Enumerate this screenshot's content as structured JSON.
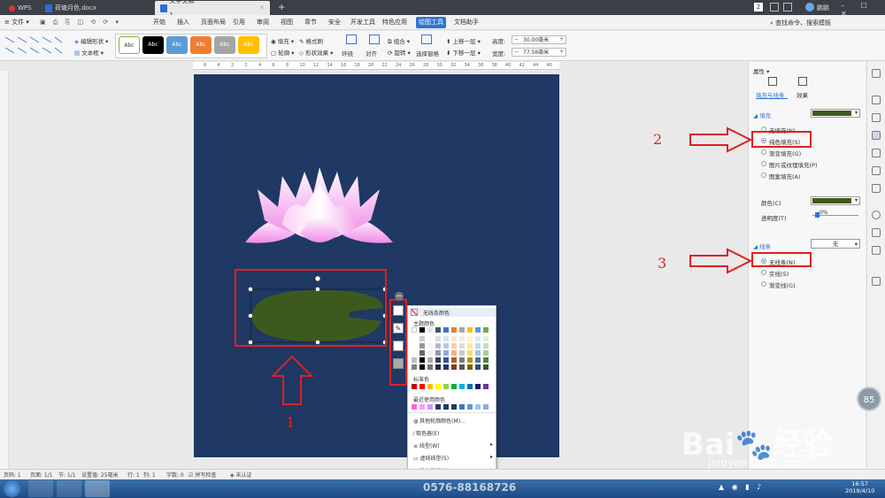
{
  "titlebar": {
    "tabs": [
      {
        "label": "WPS"
      },
      {
        "label": "荷塘月色.docx"
      },
      {
        "label": "文字文稿1"
      }
    ],
    "page_count": "2",
    "user": "鹏鹏"
  },
  "menubar": {
    "file": "文件",
    "items": [
      "开始",
      "插入",
      "页面布局",
      "引用",
      "审阅",
      "视图",
      "章节",
      "安全",
      "开发工具",
      "特色应用",
      "绘图工具",
      "文档助手"
    ],
    "active": "绘图工具",
    "search": "查找命令、搜索模板"
  },
  "ribbon": {
    "edit_shape": "编辑形状",
    "textbox": "文本框",
    "style_label": "Abc",
    "fill": "填充",
    "format_painter": "格式刷",
    "outline": "轮廓",
    "shape_effect": "形状效果",
    "wrap": "环绕",
    "align": "对齐",
    "group": "组合",
    "rotate": "旋转",
    "selection_pane": "选择窗格",
    "bring_forward": "上移一层",
    "send_backward": "下移一层",
    "height_label": "高度:",
    "height_value": "30.00毫米",
    "width_label": "宽度:",
    "width_value": "77.56毫米"
  },
  "ruler": [
    "6",
    "4",
    "2",
    "2",
    "4",
    "6",
    "8",
    "10",
    "12",
    "14",
    "16",
    "18",
    "20",
    "22",
    "24",
    "26",
    "28",
    "30",
    "32",
    "34",
    "36",
    "38",
    "40",
    "42",
    "44",
    "46"
  ],
  "panel": {
    "title": "属性",
    "tab_fill": "填充与线条",
    "tab_effect": "效果",
    "fill_section": "填充",
    "fill_color": "#3d5a1e",
    "fill_options": [
      "无填充(N)",
      "纯色填充(S)",
      "渐变填充(G)",
      "图片或纹理填充(P)",
      "图案填充(A)"
    ],
    "fill_selected": 1,
    "color_label": "颜色(C)",
    "transparency_label": "透明度(T)",
    "transparency_value": "0%",
    "line_section": "线条",
    "line_value": "无",
    "line_options": [
      "无线条(N)",
      "实线(S)",
      "渐变线(G)"
    ],
    "line_selected": 0
  },
  "popup": {
    "no_line": "无线条颜色",
    "theme_colors": "主题颜色",
    "standard_colors": "标准色",
    "recent_colors": "最近使用颜色",
    "more_colors": "其他轮廓颜色(M)...",
    "eyedropper": "取色器(E)",
    "line_type": "线型(W)",
    "dash_type": "虚线线型(S)",
    "arrow_style": "箭头样式(R)",
    "theme_top": [
      "#ffffff",
      "#000000",
      "#e7e6e6",
      "#44546a",
      "#4472c4",
      "#ed7d31",
      "#a5a5a5",
      "#ffc000",
      "#5b9bd5",
      "#70ad47"
    ],
    "standard": [
      "#c00000",
      "#ff0000",
      "#ffc000",
      "#ffff00",
      "#92d050",
      "#00b050",
      "#00b0f0",
      "#0070c0",
      "#002060",
      "#7030a0"
    ],
    "recent": [
      "#ff66cc",
      "#ff99ff",
      "#cc99ff",
      "#1f3864",
      "#203864",
      "#1f3a5f",
      "#4472c4",
      "#5b9bd5",
      "#9dc3e6",
      "#8faadc"
    ]
  },
  "annotations": {
    "n1": "1",
    "n2": "2",
    "n3": "3"
  },
  "status": {
    "page": "页码: 1",
    "pages": "页面: 1/1",
    "section": "节: 1/1",
    "setting": "设置值: 25毫米",
    "row": "行: 1",
    "col": "列: 1",
    "words": "字数: 0",
    "spell": "拼写检查",
    "auth": "未认证"
  },
  "zoom_badge": "85",
  "taskbar": {
    "phone": "0576-88168726",
    "time": "16:57",
    "date": "2019/4/10"
  },
  "watermark": {
    "brand": "Bai",
    "brand2": "经验",
    "url": "jingyan.baidu.com"
  }
}
